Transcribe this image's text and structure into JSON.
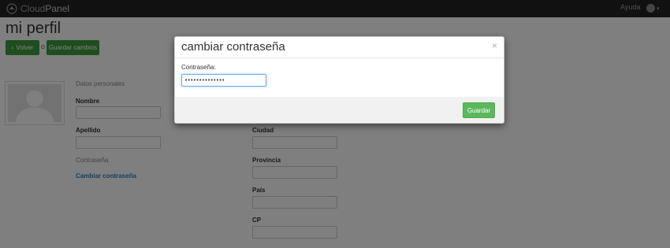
{
  "navbar": {
    "brand_prefix": "Cloud",
    "brand_strong": "Panel",
    "help_label": "Ayuda",
    "caret": "▾"
  },
  "page": {
    "title": "mi perfil",
    "back_label": "Volver",
    "separator": "o",
    "save_changes_label": "Guardar cambios",
    "personal_section_label": "Datos personales",
    "first_name_label": "Nombre",
    "last_name_label": "Apellido",
    "password_section_label": "Contraseña",
    "change_password_link": "Cambiar contraseña",
    "city_label": "Ciudad",
    "province_label": "Provincia",
    "country_label": "País",
    "postal_code_label": "CP"
  },
  "modal": {
    "title": "cambiar contraseña",
    "close_glyph": "×",
    "password_label": "Contraseña:",
    "password_value": "••••••••••••••",
    "save_label": "Guardar"
  },
  "colors": {
    "navbar_bg": "#222222",
    "primary_green": "#5cb85c",
    "dark_green": "#3c9b3c",
    "link_blue": "#2a7fbf",
    "focus_blue": "#66afe9"
  }
}
